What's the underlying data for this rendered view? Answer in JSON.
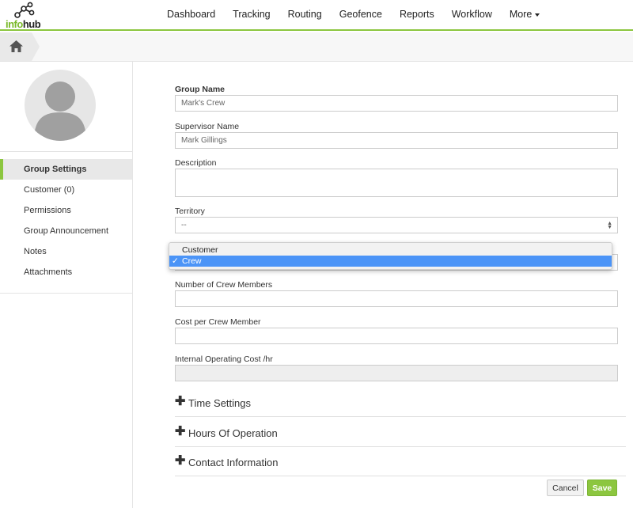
{
  "brand": {
    "logo_part1": "info",
    "logo_part2": "hub",
    "accent_color": "#8cc63f"
  },
  "nav": {
    "items": [
      "Dashboard",
      "Tracking",
      "Routing",
      "Geofence",
      "Reports",
      "Workflow"
    ],
    "more_label": "More"
  },
  "breadcrumb": {
    "home_icon": "home-icon"
  },
  "sidebar": {
    "avatar_icon": "user-silhouette-icon",
    "items": [
      {
        "label": "Group Settings",
        "active": true
      },
      {
        "label": "Customer (0)"
      },
      {
        "label": "Permissions"
      },
      {
        "label": "Group Announcement"
      },
      {
        "label": "Notes"
      },
      {
        "label": "Attachments"
      }
    ]
  },
  "form": {
    "group_name": {
      "label": "Group Name",
      "value": "Mark's Crew"
    },
    "supervisor_name": {
      "label": "Supervisor Name",
      "value": "Mark Gillings"
    },
    "description": {
      "label": "Description",
      "value": ""
    },
    "territory": {
      "label": "Territory",
      "value": "--"
    },
    "type": {
      "options": [
        "Customer",
        "Crew"
      ],
      "selected": "Crew",
      "check_glyph": "✓"
    },
    "crew_members": {
      "label": "Number of Crew Members",
      "value": ""
    },
    "cost_per_member": {
      "label": "Cost per Crew Member",
      "value": ""
    },
    "operating_cost": {
      "label": "Internal Operating Cost /hr",
      "value": ""
    }
  },
  "sections": [
    {
      "title": "Time Settings"
    },
    {
      "title": "Hours Of Operation"
    },
    {
      "title": "Contact Information"
    }
  ],
  "actions": {
    "cancel_label": "Cancel",
    "save_label": "Save"
  }
}
